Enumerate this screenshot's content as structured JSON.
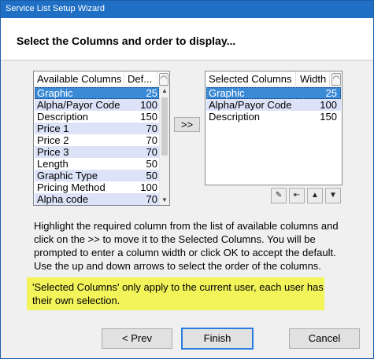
{
  "window": {
    "title": "Service List Setup Wizard"
  },
  "header": {
    "title": "Select the Columns and order to display..."
  },
  "available": {
    "col_name": "Available Columns",
    "col_width": "Def...",
    "corner_glyph": "◠",
    "rows": [
      {
        "name": "Graphic",
        "width": "25",
        "state": "selected"
      },
      {
        "name": "Alpha/Payor Code",
        "width": "100",
        "state": "alt"
      },
      {
        "name": "Description",
        "width": "150",
        "state": ""
      },
      {
        "name": "Price 1",
        "width": "70",
        "state": "alt"
      },
      {
        "name": "Price 2",
        "width": "70",
        "state": ""
      },
      {
        "name": "Price 3",
        "width": "70",
        "state": "alt"
      },
      {
        "name": "Length",
        "width": "50",
        "state": ""
      },
      {
        "name": "Graphic Type",
        "width": "50",
        "state": "alt"
      },
      {
        "name": "Pricing Method",
        "width": "100",
        "state": ""
      },
      {
        "name": "Alpha code",
        "width": "70",
        "state": "alt"
      }
    ]
  },
  "selected": {
    "col_name": "Selected Columns",
    "col_width": "Width",
    "corner_glyph": "◠",
    "rows": [
      {
        "name": "Graphic",
        "width": "25",
        "state": "selected"
      },
      {
        "name": "Alpha/Payor Code",
        "width": "100",
        "state": "alt"
      },
      {
        "name": "Description",
        "width": "150",
        "state": ""
      }
    ]
  },
  "buttons": {
    "move_right": ">>",
    "prev": "< Prev",
    "finish": "Finish",
    "cancel": "Cancel"
  },
  "tools": {
    "edit_glyph": "✎",
    "remove_glyph": "⇤",
    "up_glyph": "▲",
    "down_glyph": "▼"
  },
  "help_text": "Highlight the required column from the list of available columns and click on the >> to move it to the Selected Columns. You will be prompted to enter a column width or click OK to accept the default. Use the up and down arrows to select the order of the columns.",
  "note_text": "'Selected Columns' only apply to the current user, each user has their own selection."
}
